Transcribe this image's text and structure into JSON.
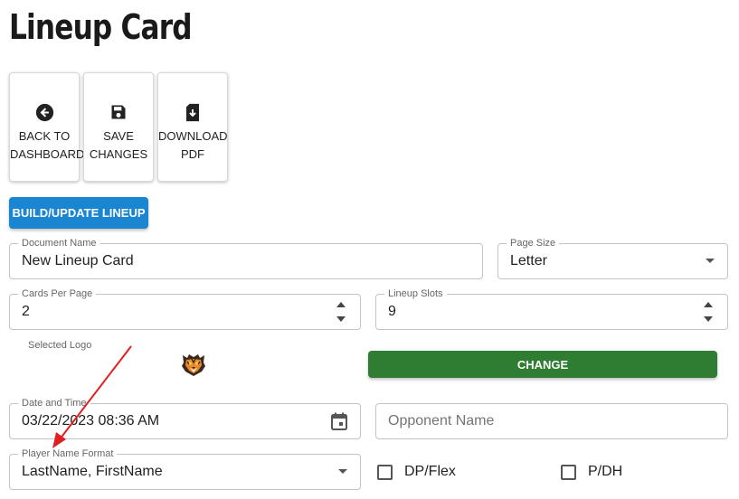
{
  "page": {
    "title": "Lineup Card"
  },
  "toolbar": {
    "back": {
      "line1": "Back to",
      "line2": "Dashboard",
      "icon": "arrow-left-circle-icon"
    },
    "save": {
      "line1": "Save",
      "line2": "Changes",
      "icon": "floppy-disk-icon"
    },
    "download": {
      "line1": "Download",
      "line2": "PDF",
      "icon": "file-download-icon"
    }
  },
  "build_button": {
    "label": "Build/Update Lineup",
    "color": "#1a85d0"
  },
  "form": {
    "document_name": {
      "label": "Document Name",
      "value": "New Lineup Card"
    },
    "page_size": {
      "label": "Page Size",
      "value": "Letter"
    },
    "cards_per_page": {
      "label": "Cards Per Page",
      "value": "2"
    },
    "lineup_slots": {
      "label": "Lineup Slots",
      "value": "9"
    },
    "logo": {
      "label": "Selected Logo",
      "icon": "tiger-logo-icon"
    },
    "change_button": {
      "label": "Change",
      "color": "#2e7d32"
    },
    "date_time": {
      "label": "Date and Time",
      "value": "03/22/2023 08:36 AM",
      "icon": "calendar-icon"
    },
    "opponent_name": {
      "placeholder": "Opponent Name"
    },
    "player_name_format": {
      "label": "Player Name Format",
      "value": "LastName, FirstName"
    },
    "dp_flex": {
      "label": "DP/Flex",
      "checked": false
    },
    "p_dh": {
      "label": "P/DH",
      "checked": false
    }
  },
  "annotation": {
    "color": "#e02020",
    "icon": "red-arrow-annotation"
  }
}
